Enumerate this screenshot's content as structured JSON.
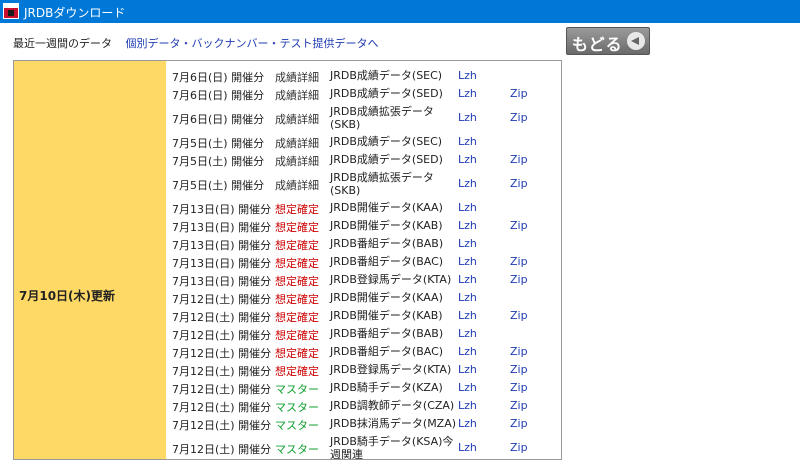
{
  "window": {
    "title": "JRDBダウンロード"
  },
  "header": {
    "recent_label": "最近一週間のデータ",
    "link_label": "個別データ・バックナンバー・テスト提供データへ",
    "back_label": "もどる"
  },
  "update": {
    "date_label": "7月10日(木)更新"
  },
  "colors": {
    "detail": "#333333",
    "kakutei": "#cc0000",
    "master": "#10a030"
  },
  "rows": [
    {
      "date": "7月6日(日) 開催分",
      "kind": "成績詳細",
      "kind_type": "detail",
      "name": "JRDB成績データ(SEC)",
      "lzh": "Lzh",
      "zip": "",
      "tall": false
    },
    {
      "date": "7月6日(日) 開催分",
      "kind": "成績詳細",
      "kind_type": "detail",
      "name": "JRDB成績データ(SED)",
      "lzh": "Lzh",
      "zip": "Zip",
      "tall": false
    },
    {
      "date": "7月6日(日) 開催分",
      "kind": "成績詳細",
      "kind_type": "detail",
      "name": "JRDB成績拡張データ",
      "name2": "(SKB)",
      "lzh": "Lzh",
      "zip": "Zip",
      "tall": true
    },
    {
      "date": "7月5日(土) 開催分",
      "kind": "成績詳細",
      "kind_type": "detail",
      "name": "JRDB成績データ(SEC)",
      "lzh": "Lzh",
      "zip": "",
      "tall": false
    },
    {
      "date": "7月5日(土) 開催分",
      "kind": "成績詳細",
      "kind_type": "detail",
      "name": "JRDB成績データ(SED)",
      "lzh": "Lzh",
      "zip": "Zip",
      "tall": false
    },
    {
      "date": "7月5日(土) 開催分",
      "kind": "成績詳細",
      "kind_type": "detail",
      "name": "JRDB成績拡張データ",
      "name2": "(SKB)",
      "lzh": "Lzh",
      "zip": "Zip",
      "tall": true
    },
    {
      "date": "7月13日(日) 開催分",
      "kind": "想定確定",
      "kind_type": "kakutei",
      "name": "JRDB開催データ(KAA)",
      "lzh": "Lzh",
      "zip": "",
      "tall": false
    },
    {
      "date": "7月13日(日) 開催分",
      "kind": "想定確定",
      "kind_type": "kakutei",
      "name": "JRDB開催データ(KAB)",
      "lzh": "Lzh",
      "zip": "Zip",
      "tall": false
    },
    {
      "date": "7月13日(日) 開催分",
      "kind": "想定確定",
      "kind_type": "kakutei",
      "name": "JRDB番組データ(BAB)",
      "lzh": "Lzh",
      "zip": "",
      "tall": false
    },
    {
      "date": "7月13日(日) 開催分",
      "kind": "想定確定",
      "kind_type": "kakutei",
      "name": "JRDB番組データ(BAC)",
      "lzh": "Lzh",
      "zip": "Zip",
      "tall": false
    },
    {
      "date": "7月13日(日) 開催分",
      "kind": "想定確定",
      "kind_type": "kakutei",
      "name": "JRDB登録馬データ(KTA)",
      "lzh": "Lzh",
      "zip": "Zip",
      "tall": false
    },
    {
      "date": "7月12日(土) 開催分",
      "kind": "想定確定",
      "kind_type": "kakutei",
      "name": "JRDB開催データ(KAA)",
      "lzh": "Lzh",
      "zip": "",
      "tall": false
    },
    {
      "date": "7月12日(土) 開催分",
      "kind": "想定確定",
      "kind_type": "kakutei",
      "name": "JRDB開催データ(KAB)",
      "lzh": "Lzh",
      "zip": "Zip",
      "tall": false
    },
    {
      "date": "7月12日(土) 開催分",
      "kind": "想定確定",
      "kind_type": "kakutei",
      "name": "JRDB番組データ(BAB)",
      "lzh": "Lzh",
      "zip": "",
      "tall": false
    },
    {
      "date": "7月12日(土) 開催分",
      "kind": "想定確定",
      "kind_type": "kakutei",
      "name": "JRDB番組データ(BAC)",
      "lzh": "Lzh",
      "zip": "Zip",
      "tall": false
    },
    {
      "date": "7月12日(土) 開催分",
      "kind": "想定確定",
      "kind_type": "kakutei",
      "name": "JRDB登録馬データ(KTA)",
      "lzh": "Lzh",
      "zip": "Zip",
      "tall": false
    },
    {
      "date": "7月12日(土) 開催分",
      "kind": "マスター",
      "kind_type": "master",
      "name": "JRDB騎手データ(KZA)",
      "lzh": "Lzh",
      "zip": "Zip",
      "tall": false
    },
    {
      "date": "7月12日(土) 開催分",
      "kind": "マスター",
      "kind_type": "master",
      "name": "JRDB調教師データ(CZA)",
      "lzh": "Lzh",
      "zip": "Zip",
      "tall": false
    },
    {
      "date": "7月12日(土) 開催分",
      "kind": "マスター",
      "kind_type": "master",
      "name": "JRDB抹消馬データ(MZA)",
      "lzh": "Lzh",
      "zip": "Zip",
      "tall": false
    },
    {
      "date": "7月12日(土) 開催分",
      "kind": "マスター",
      "kind_type": "master",
      "name": "JRDB騎手データ(KSA)今",
      "name2": "週関連",
      "lzh": "Lzh",
      "zip": "Zip",
      "tall": true
    }
  ]
}
